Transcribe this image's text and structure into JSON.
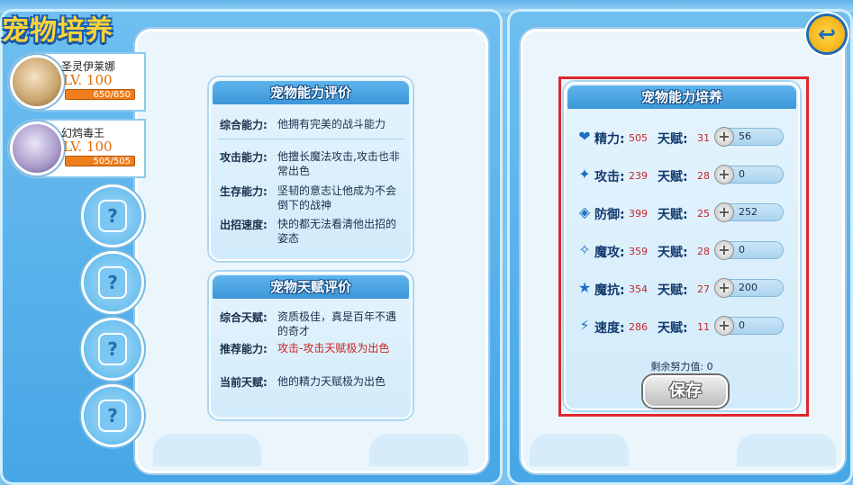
{
  "header": {
    "title": "宠物培养"
  },
  "pets": [
    {
      "name": "圣灵伊莱娜",
      "level": "LV. 100",
      "hp": "650/650"
    },
    {
      "name": "幻鸩毒王",
      "level": "LV. 100",
      "hp": "505/505"
    }
  ],
  "empty_slot_icon": "?",
  "ability_eval": {
    "title": "宠物能力评价",
    "rows": [
      {
        "label": "综合能力:",
        "value": "他拥有完美的战斗能力"
      },
      {
        "label": "攻击能力:",
        "value": "他擅长魔法攻击,攻击也非常出色"
      },
      {
        "label": "生存能力:",
        "value": "坚韧的意志让他成为不会倒下的战神"
      },
      {
        "label": "出招速度:",
        "value": "快的都无法看清他出招的姿态"
      }
    ]
  },
  "talent_eval": {
    "title": "宠物天赋评价",
    "rows": [
      {
        "label": "综合天赋:",
        "value": "资质极佳，真是百年不遇的奇才"
      },
      {
        "label": "推荐能力:",
        "value": "攻击-攻击天赋极为出色"
      },
      {
        "label": "当前天赋:",
        "value": "他的精力天赋极为出色"
      }
    ]
  },
  "training": {
    "title": "宠物能力培养",
    "talent_label": "天赋:",
    "stats": [
      {
        "icon": "heart-icon",
        "glyph": "❤",
        "name": "精力:",
        "value": "505",
        "talent": "31",
        "effort": "56"
      },
      {
        "icon": "sword-icon",
        "glyph": "✦",
        "name": "攻击:",
        "value": "239",
        "talent": "28",
        "effort": "0"
      },
      {
        "icon": "shield-icon",
        "glyph": "◈",
        "name": "防御:",
        "value": "399",
        "talent": "25",
        "effort": "252"
      },
      {
        "icon": "wand-icon",
        "glyph": "✧",
        "name": "魔攻:",
        "value": "359",
        "talent": "28",
        "effort": "0"
      },
      {
        "icon": "star-shield-icon",
        "glyph": "★",
        "name": "魔抗:",
        "value": "354",
        "talent": "27",
        "effort": "200"
      },
      {
        "icon": "lightning-icon",
        "glyph": "⚡",
        "name": "速度:",
        "value": "286",
        "talent": "11",
        "effort": "0"
      }
    ],
    "remaining": "剩余努力值: 0",
    "save_label": "保存"
  }
}
